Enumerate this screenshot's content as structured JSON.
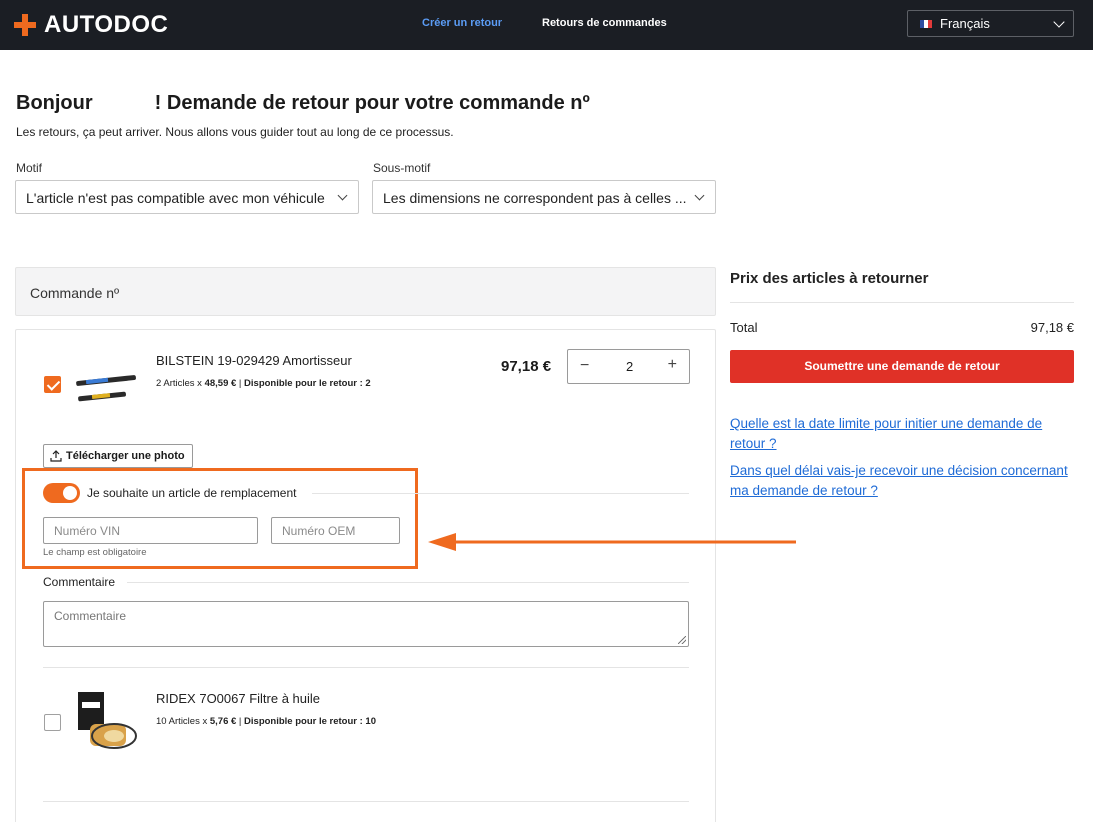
{
  "header": {
    "logo_text": "AUTODOC",
    "nav": [
      {
        "label": "Créer un retour",
        "active": true
      },
      {
        "label": "Retours de commandes",
        "active": false
      }
    ],
    "language": {
      "selected": "Français",
      "icon": "flag-fr-icon"
    }
  },
  "page": {
    "title_start": "Bonjour",
    "title_end": "! Demande de retour pour votre commande nº",
    "subtitle": "Les retours, ça peut arriver. Nous allons vous guider tout au long de ce processus."
  },
  "reason": {
    "label": "Motif",
    "value": "L'article n'est pas compatible avec mon véhicule"
  },
  "sub_reason": {
    "label": "Sous-motif",
    "value": "Les dimensions ne correspondent pas à celles ..."
  },
  "order": {
    "header_label": "Commande nº",
    "products": [
      {
        "name": "BILSTEIN 19-029429 Amortisseur",
        "quantity_text": "2 Articles x",
        "unit_price": "48,59 €",
        "available_label": "Disponible pour le retour : 2",
        "price": "97,18 €",
        "quantity": "2",
        "checked": true
      },
      {
        "name": "RIDEX 7O0067 Filtre à huile",
        "quantity_text": "10 Articles x",
        "unit_price": "5,76 €",
        "available_label": "Disponible pour le retour : 10",
        "checked": false
      }
    ],
    "upload_label": "Télécharger une photo",
    "replacement_label": "Je souhaite un article de remplacement",
    "vin_placeholder": "Numéro VIN",
    "oem_placeholder": "Numéro OEM",
    "required_hint": "Le champ est obligatoire",
    "comment_label": "Commentaire",
    "comment_placeholder": "Commentaire"
  },
  "summary": {
    "title": "Prix des articles à retourner",
    "total_label": "Total",
    "total_value": "97,18 €",
    "submit_label": "Soumettre une demande de retour",
    "faq": [
      "Quelle est la date limite pour initier une demande de retour ?",
      "Dans quel délai vais-je recevoir une décision concernant ma demande de retour ?"
    ]
  },
  "colors": {
    "brand": "#ef6a1f",
    "submit": "#e03127",
    "link": "#1f6bd6",
    "header_bg": "#1b1e24"
  }
}
